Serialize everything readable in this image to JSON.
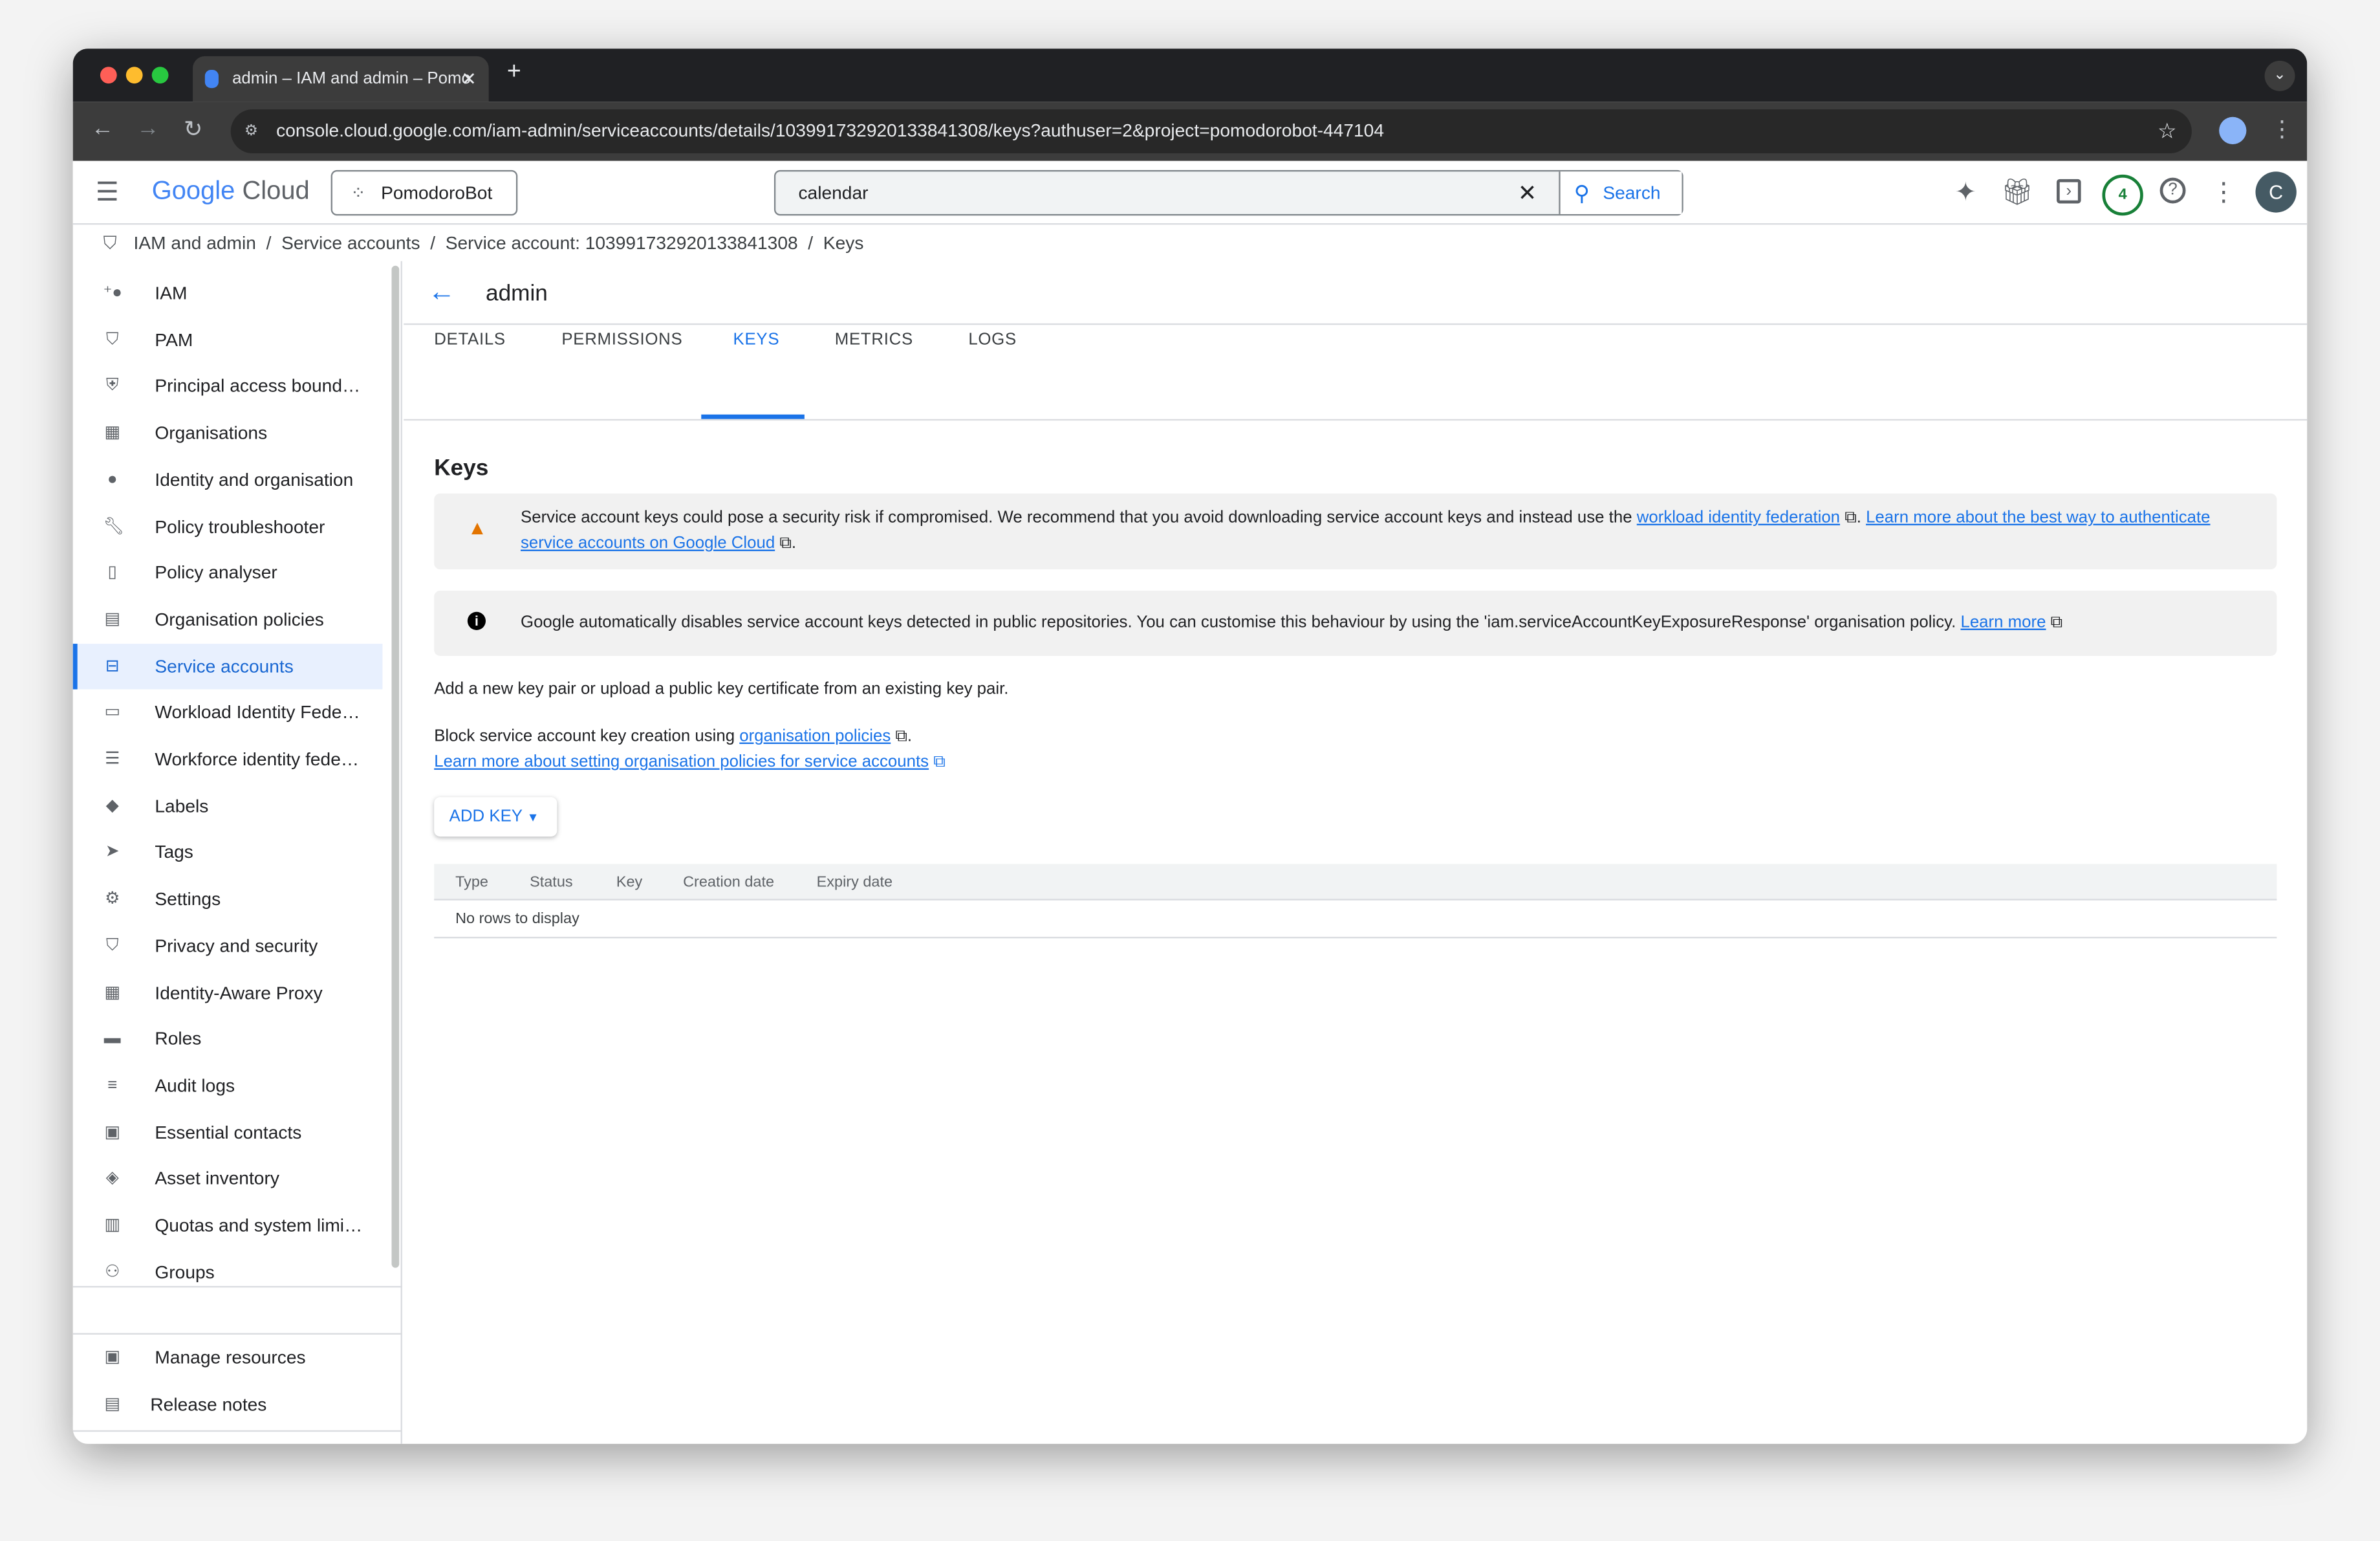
{
  "browser": {
    "tab_title": "admin – IAM and admin – Pomo",
    "url": "console.cloud.google.com/iam-admin/serviceaccounts/details/103991732920133841308/keys?authuser=2&project=pomodorobot-447104"
  },
  "header": {
    "logo_google": "Google",
    "logo_cloud": "Cloud",
    "project": "PomodoroBot",
    "search_value": "calendar",
    "search_button": "Search",
    "notifications_count": "4",
    "avatar_initial": "C"
  },
  "breadcrumb": [
    "IAM and admin",
    "Service accounts",
    "Service account: 103991732920133841308",
    "Keys"
  ],
  "sidebar": {
    "items": [
      {
        "label": "IAM",
        "icon": "person-add"
      },
      {
        "label": "PAM",
        "icon": "shield"
      },
      {
        "label": "Principal access bound…",
        "icon": "policy"
      },
      {
        "label": "Organisations",
        "icon": "building"
      },
      {
        "label": "Identity and organisation",
        "icon": "account-circle"
      },
      {
        "label": "Policy troubleshooter",
        "icon": "wrench"
      },
      {
        "label": "Policy analyser",
        "icon": "doc-search"
      },
      {
        "label": "Organisation policies",
        "icon": "list-doc"
      },
      {
        "label": "Service accounts",
        "icon": "service-account",
        "active": true
      },
      {
        "label": "Workload Identity Fede…",
        "icon": "id-card"
      },
      {
        "label": "Workforce identity fede…",
        "icon": "list"
      },
      {
        "label": "Labels",
        "icon": "label"
      },
      {
        "label": "Tags",
        "icon": "tag"
      },
      {
        "label": "Settings",
        "icon": "gear"
      },
      {
        "label": "Privacy and security",
        "icon": "shield-lock"
      },
      {
        "label": "Identity-Aware Proxy",
        "icon": "proxy"
      },
      {
        "label": "Roles",
        "icon": "hat"
      },
      {
        "label": "Audit logs",
        "icon": "lines"
      },
      {
        "label": "Essential contacts",
        "icon": "contact"
      },
      {
        "label": "Asset inventory",
        "icon": "diamond"
      },
      {
        "label": "Quotas and system limi…",
        "icon": "table"
      },
      {
        "label": "Groups",
        "icon": "group"
      }
    ],
    "manage_resources": "Manage resources",
    "release_notes": "Release notes"
  },
  "main": {
    "title": "admin",
    "tabs": [
      "DETAILS",
      "PERMISSIONS",
      "KEYS",
      "METRICS",
      "LOGS"
    ],
    "active_tab": "KEYS",
    "heading": "Keys",
    "warning": {
      "text": "Service account keys could pose a security risk if compromised. We recommend that you avoid downloading service account keys and instead use the ",
      "link1": "workload identity federation",
      "mid": ". ",
      "link2": "Learn more about the best way to authenticate service accounts on Google Cloud",
      "end": "."
    },
    "info": {
      "text": "Google automatically disables service account keys detected in public repositories. You can customise this behaviour by using the 'iam.serviceAccountKeyExposureResponse' organisation policy. ",
      "link": "Learn more"
    },
    "add_text": "Add a new key pair or upload a public key certificate from an existing key pair.",
    "block_text": "Block service account key creation using ",
    "block_link": "organisation policies",
    "block_end": ".",
    "learn_link": "Learn more about setting organisation policies for service accounts",
    "add_key": "ADD KEY",
    "table": {
      "columns": [
        "Type",
        "Status",
        "Key",
        "Creation date",
        "Expiry date"
      ],
      "empty": "No rows to display"
    }
  },
  "colors": {
    "accent": "#1a73e8",
    "warning": "#e37400",
    "badge": "#188038",
    "avatar": "#455a64"
  }
}
